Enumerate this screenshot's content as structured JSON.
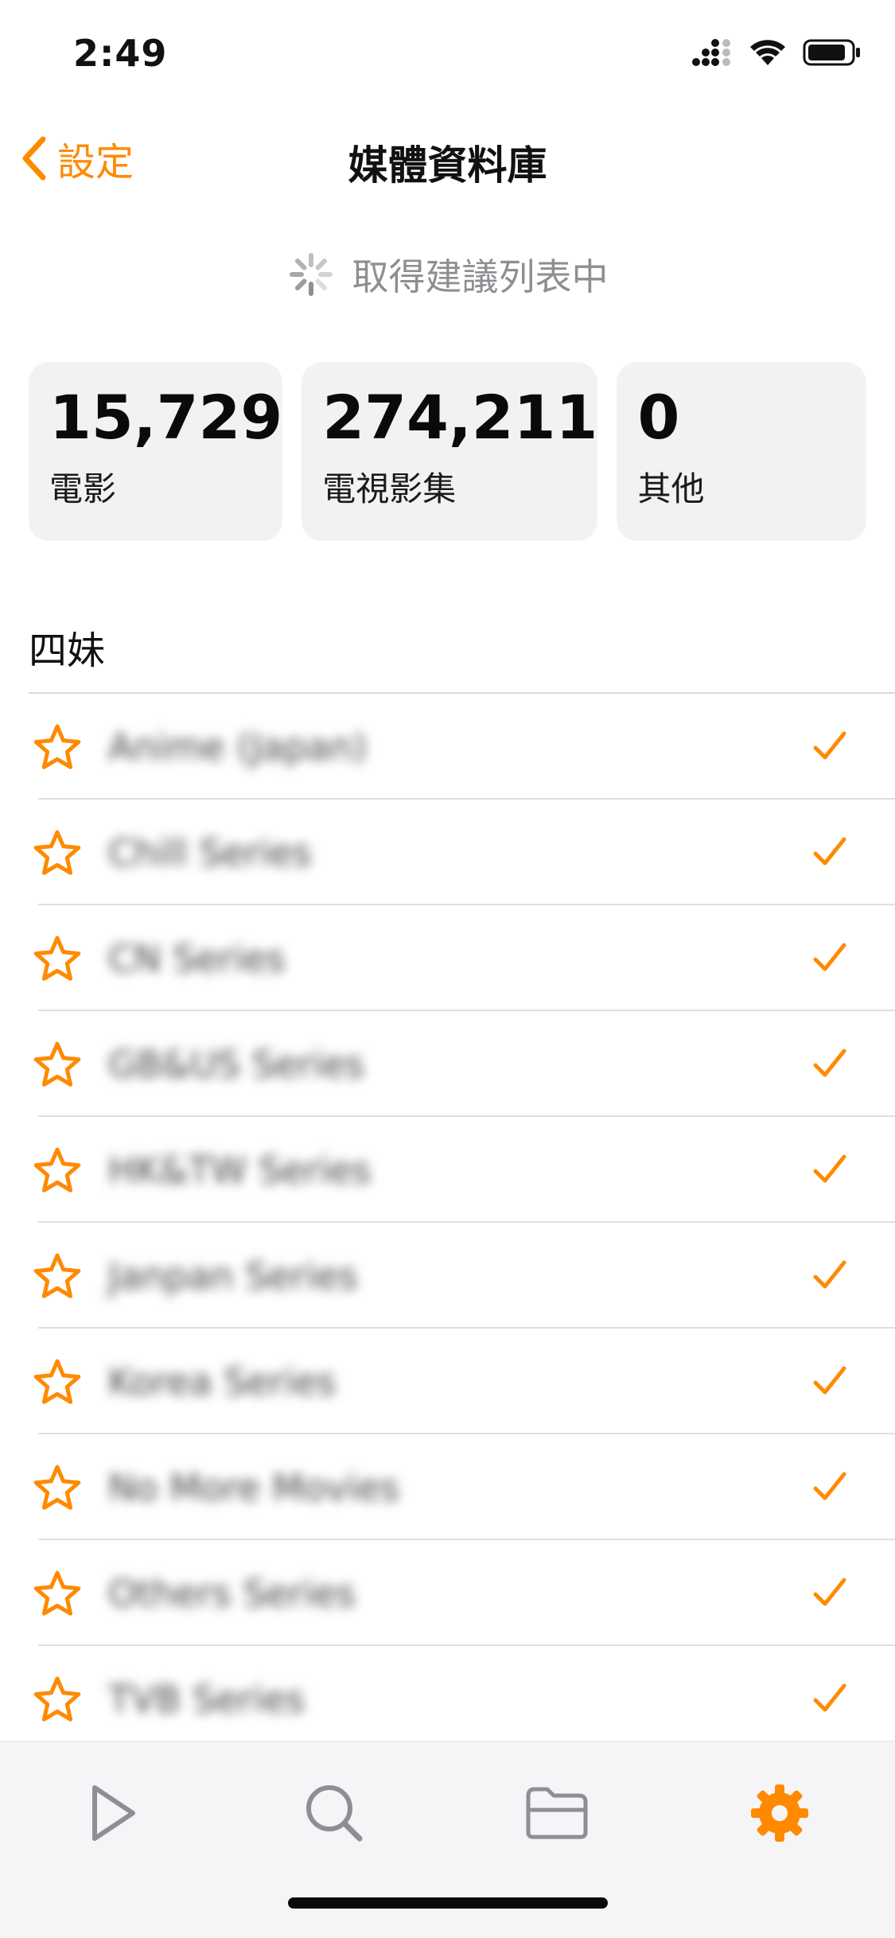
{
  "status_bar": {
    "time": "2:49"
  },
  "nav": {
    "back_label": "設定",
    "title": "媒體資料庫"
  },
  "loading": {
    "text": "取得建議列表中"
  },
  "stats": [
    {
      "value": "15,729",
      "label": "電影"
    },
    {
      "value": "274,211",
      "label": "電視影集"
    },
    {
      "value": "0",
      "label": "其他"
    }
  ],
  "section": {
    "title": "四妹"
  },
  "libraries": [
    {
      "name": "Anime (Japan)",
      "favorite_icon": "star-outline-icon",
      "selected": true
    },
    {
      "name": "Chill Series",
      "favorite_icon": "star-outline-icon",
      "selected": true
    },
    {
      "name": "CN Series",
      "favorite_icon": "star-outline-icon",
      "selected": true
    },
    {
      "name": "GB&US Series",
      "favorite_icon": "star-outline-icon",
      "selected": true
    },
    {
      "name": "HK&TW Series",
      "favorite_icon": "star-outline-icon",
      "selected": true
    },
    {
      "name": "Janpan Series",
      "favorite_icon": "star-outline-icon",
      "selected": true
    },
    {
      "name": "Korea Series",
      "favorite_icon": "star-outline-icon",
      "selected": true
    },
    {
      "name": "No More Movies",
      "favorite_icon": "star-outline-icon",
      "selected": true
    },
    {
      "name": "Others Series",
      "favorite_icon": "star-outline-icon",
      "selected": true
    },
    {
      "name": "TVB Series",
      "favorite_icon": "star-outline-icon",
      "selected": true
    }
  ],
  "tab_bar": {
    "tabs": [
      {
        "icon": "play-icon",
        "active": false
      },
      {
        "icon": "search-icon",
        "active": false
      },
      {
        "icon": "folder-icon",
        "active": false
      },
      {
        "icon": "gear-icon",
        "active": true
      }
    ]
  },
  "colors": {
    "accent": "#ff8a00",
    "card_bg": "#f2f2f4",
    "secondary_text": "#8e8e93",
    "tab_inactive": "#8e8e93"
  }
}
